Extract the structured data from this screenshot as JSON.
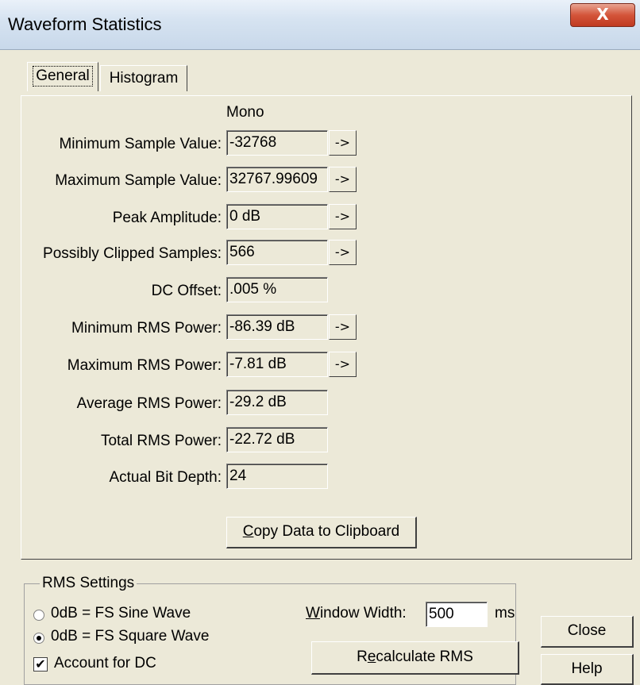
{
  "window": {
    "title": "Waveform Statistics",
    "close_glyph": "X"
  },
  "tabs": [
    {
      "label": "General",
      "active": true
    },
    {
      "label": "Histogram",
      "active": false
    }
  ],
  "general": {
    "channel_header": "Mono",
    "rows": [
      {
        "label": "Minimum Sample Value:",
        "value": "-32768",
        "has_arrow": true
      },
      {
        "label": "Maximum Sample Value:",
        "value": "32767.99609",
        "has_arrow": true
      },
      {
        "label": "Peak Amplitude:",
        "value": "0 dB",
        "has_arrow": true
      },
      {
        "label": "Possibly Clipped Samples:",
        "value": "566",
        "has_arrow": true
      },
      {
        "label": "DC Offset:",
        "value": ".005 %",
        "has_arrow": false
      },
      {
        "label": "Minimum RMS Power:",
        "value": "-86.39 dB",
        "has_arrow": true
      },
      {
        "label": "Maximum RMS Power:",
        "value": "-7.81 dB",
        "has_arrow": true
      },
      {
        "label": "Average RMS Power:",
        "value": "-29.2 dB",
        "has_arrow": false
      },
      {
        "label": "Total RMS Power:",
        "value": "-22.72 dB",
        "has_arrow": false
      },
      {
        "label": "Actual Bit Depth:",
        "value": "24",
        "has_arrow": false
      }
    ],
    "arrow_label": "->",
    "copy_button": {
      "mnemonic": "C",
      "rest": "opy Data to Clipboard"
    }
  },
  "rms_settings": {
    "title": "RMS Settings",
    "options": [
      {
        "label": "0dB = FS Sine Wave",
        "selected": false
      },
      {
        "label": "0dB = FS Square Wave",
        "selected": true
      }
    ],
    "account_for_dc": {
      "label": "Account for DC",
      "checked": true,
      "mark": "✔"
    },
    "window_width": {
      "mnemonic": "W",
      "rest": "indow Width:",
      "value": "500",
      "unit": "ms"
    },
    "recalc_button": {
      "pre": "R",
      "mnemonic": "e",
      "rest": "calculate RMS"
    }
  },
  "buttons": {
    "close": "Close",
    "help": "Help"
  }
}
